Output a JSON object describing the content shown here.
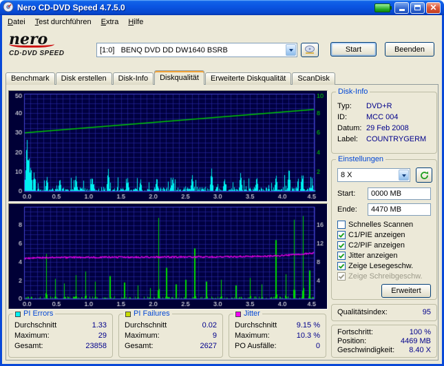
{
  "window": {
    "title": "Nero CD-DVD Speed 4.7.5.0"
  },
  "menu": {
    "items": [
      {
        "label": "Datei"
      },
      {
        "label": "Test durchführen"
      },
      {
        "label": "Extra"
      },
      {
        "label": "Hilfe"
      }
    ]
  },
  "logo": {
    "line1": "nero",
    "line2": "CD·DVD SPEED"
  },
  "header": {
    "drive": "[1:0]   BENQ DVD DD DW1640 BSRB",
    "start_button": "Start",
    "exit_button": "Beenden"
  },
  "tabs": {
    "active_index": 3,
    "items": [
      "Benchmark",
      "Disk erstellen",
      "Disk-Info",
      "Diskqualität",
      "Erweiterte Diskqualität",
      "ScanDisk"
    ]
  },
  "disk_info": {
    "title": "Disk-Info",
    "rows": [
      {
        "label": "Typ:",
        "value": "DVD+R"
      },
      {
        "label": "ID:",
        "value": "MCC 004"
      },
      {
        "label": "Datum:",
        "value": "29 Feb 2008"
      },
      {
        "label": "Label:",
        "value": "COUNTRYGERM"
      }
    ]
  },
  "settings": {
    "title": "Einstellungen",
    "speed_value": "8 X",
    "start_label": "Start:",
    "start_value": "0000 MB",
    "end_label": "Ende:",
    "end_value": "4470 MB",
    "checkboxes": [
      {
        "label": "Schnelles Scannen",
        "checked": false,
        "disabled": false
      },
      {
        "label": "C1/PIE anzeigen",
        "checked": true,
        "disabled": false
      },
      {
        "label": "C2/PIF anzeigen",
        "checked": true,
        "disabled": false
      },
      {
        "label": "Jitter anzeigen",
        "checked": true,
        "disabled": false
      },
      {
        "label": "Zeige Lesegeschw.",
        "checked": true,
        "disabled": false
      },
      {
        "label": "Zeige Schreibgeschw.",
        "checked": true,
        "disabled": true
      }
    ],
    "advanced_button": "Erweitert"
  },
  "quality": {
    "label": "Qualitätsindex:",
    "value": "95"
  },
  "progress": {
    "rows": [
      {
        "label": "Fortschritt:",
        "value": "100 %"
      },
      {
        "label": "Position:",
        "value": "4469 MB"
      },
      {
        "label": "Geschwindigkeit:",
        "value": "8.40 X"
      }
    ]
  },
  "stats": [
    {
      "title": "PI Errors",
      "color": "#00F2F2",
      "rows": [
        {
          "label": "Durchschnitt",
          "value": "1.33"
        },
        {
          "label": "Maximum:",
          "value": "29"
        },
        {
          "label": "Gesamt:",
          "value": "23858"
        }
      ]
    },
    {
      "title": "PI Failures",
      "color": "#C8DC00",
      "rows": [
        {
          "label": "Durchschnitt",
          "value": "0.02"
        },
        {
          "label": "Maximum:",
          "value": "9"
        },
        {
          "label": "Gesamt:",
          "value": "2627"
        }
      ]
    },
    {
      "title": "Jitter",
      "color": "#F400F4",
      "rows": [
        {
          "label": "Durchschnitt",
          "value": "9.15 %"
        },
        {
          "label": "Maximum:",
          "value": "10.3 %"
        },
        {
          "label": "PO Ausfälle:",
          "value": "0"
        }
      ]
    }
  ],
  "chart_data": [
    {
      "type": "area",
      "name": "PI Errors und Lesegeschwindigkeit",
      "x_range": [
        0,
        4.5
      ],
      "x_ticks": [
        "0.0",
        "0.5",
        "1.0",
        "1.5",
        "2.0",
        "2.5",
        "3.0",
        "3.5",
        "4.0",
        "4.5"
      ],
      "y_left": {
        "range": [
          0,
          50
        ],
        "ticks": [
          0,
          10,
          20,
          30,
          40,
          50
        ],
        "label_color": "#F8F8F8"
      },
      "y_right": {
        "range": [
          0,
          10
        ],
        "ticks": [
          2,
          4,
          6,
          8,
          10
        ],
        "label_color": "#00DD00"
      },
      "grid": {
        "x_step": 0.1,
        "y_step": 2.5
      },
      "background": "#000040",
      "grid_color": "#2B2BB0",
      "frame_color": "#4646D2",
      "series": [
        {
          "name": "PI Errors",
          "kind": "noise-area",
          "color": "#00F2F2",
          "seed": 12,
          "base_max": 2.8,
          "minor_spike_chance": 0.12,
          "minor_spike_max": 7,
          "spikes": [
            [
              0.04,
              29
            ],
            [
              0.07,
              20
            ],
            [
              0.1,
              14
            ],
            [
              0.15,
              10
            ],
            [
              0.35,
              8
            ],
            [
              0.55,
              7
            ],
            [
              0.8,
              8
            ],
            [
              1.05,
              8
            ],
            [
              1.3,
              12
            ],
            [
              1.6,
              7
            ],
            [
              1.8,
              6
            ],
            [
              2.05,
              7
            ],
            [
              2.3,
              8
            ],
            [
              2.6,
              9
            ],
            [
              2.9,
              12
            ],
            [
              3.1,
              7
            ],
            [
              3.35,
              10
            ],
            [
              3.6,
              8
            ],
            [
              3.9,
              9
            ],
            [
              4.1,
              13
            ],
            [
              4.3,
              9
            ]
          ],
          "average": 1.33,
          "maximum": 29,
          "total": 23858
        },
        {
          "name": "Lesegeschwindigkeit",
          "kind": "line",
          "axis": "right",
          "color": "#00CC00",
          "width": 1.6,
          "points": [
            [
              0,
              6.0
            ],
            [
              4.5,
              8.4
            ]
          ],
          "end_speed_x": 8.4
        }
      ]
    },
    {
      "type": "spikes",
      "name": "PI Failures und Jitter",
      "x_range": [
        0,
        4.5
      ],
      "x_ticks": [
        "0.0",
        "0.5",
        "1.0",
        "1.5",
        "2.0",
        "2.5",
        "3.0",
        "3.5",
        "4.0",
        "4.5"
      ],
      "y_left": {
        "range": [
          0,
          10
        ],
        "ticks": [
          0,
          2,
          4,
          6,
          8
        ],
        "label_color": "#F8F8F8"
      },
      "y_right": {
        "range": [
          0,
          20
        ],
        "ticks": [
          4,
          8,
          12,
          16
        ],
        "label_color": "#F8F8F8"
      },
      "grid": {
        "x_step": 0.1,
        "y_step": 0.5
      },
      "background": "#000040",
      "grid_color": "#2B2BB0",
      "frame_color": "#4646D2",
      "series": [
        {
          "name": "PI Failures",
          "kind": "spikes",
          "color": "#00DC00",
          "seed": 5,
          "base_chance": 0.5,
          "base_max": 0.3,
          "spikes": [
            [
              0.34,
              4.9
            ],
            [
              0.48,
              2.2
            ],
            [
              0.62,
              1.7
            ],
            [
              0.8,
              2.6
            ],
            [
              0.95,
              3.0
            ],
            [
              1.1,
              1.9
            ],
            [
              1.33,
              2.5
            ],
            [
              1.55,
              1.8
            ],
            [
              1.76,
              1.5
            ],
            [
              1.95,
              1.2
            ],
            [
              2.08,
              8.8
            ],
            [
              2.2,
              3.4
            ],
            [
              2.35,
              1.6
            ],
            [
              2.5,
              2.1
            ],
            [
              2.64,
              5.5
            ],
            [
              2.82,
              1.9
            ],
            [
              3.05,
              2.1
            ],
            [
              3.28,
              1.5
            ],
            [
              3.5,
              2.3
            ],
            [
              3.68,
              1.6
            ],
            [
              3.9,
              6.4
            ],
            [
              4.05,
              2.7
            ],
            [
              4.18,
              8.6
            ],
            [
              4.32,
              9.0
            ],
            [
              4.42,
              3.1
            ]
          ],
          "average": 0.02,
          "maximum": 9,
          "total": 2627
        },
        {
          "name": "Jitter",
          "kind": "noisy-line",
          "axis": "right",
          "color": "#E400E4",
          "seed": 9,
          "noise": 0.16,
          "points": [
            [
              0,
              8.8
            ],
            [
              0.3,
              9.0
            ],
            [
              1.0,
              9.05
            ],
            [
              2.0,
              9.1
            ],
            [
              3.0,
              9.15
            ],
            [
              3.8,
              9.3
            ],
            [
              4.2,
              9.6
            ],
            [
              4.5,
              10.0
            ]
          ],
          "average_pct": 9.15,
          "maximum_pct": 10.3
        }
      ]
    }
  ]
}
